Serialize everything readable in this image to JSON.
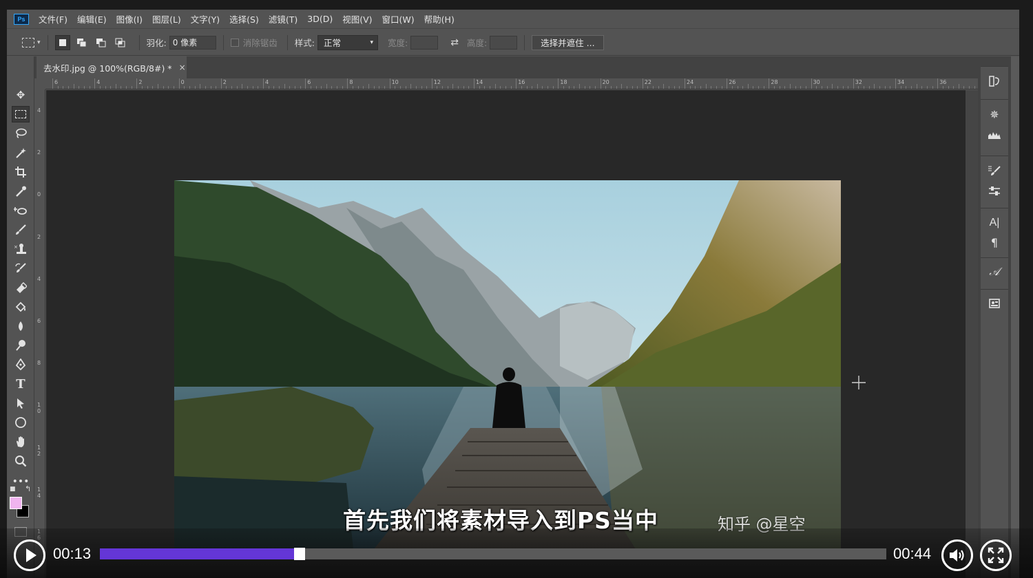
{
  "app": {
    "logo_text": "Ps"
  },
  "menu": [
    "文件(F)",
    "编辑(E)",
    "图像(I)",
    "图层(L)",
    "文字(Y)",
    "选择(S)",
    "滤镜(T)",
    "3D(D)",
    "视图(V)",
    "窗口(W)",
    "帮助(H)"
  ],
  "options_bar": {
    "feather_label": "羽化:",
    "feather_value": "0 像素",
    "antialias_label": "消除锯齿",
    "style_label": "样式:",
    "style_value": "正常",
    "width_label": "宽度:",
    "height_label": "高度:",
    "select_mask_button": "选择并遮住 ..."
  },
  "document": {
    "tab_title": "去水印.jpg @ 100%(RGB/8#) *",
    "close_glyph": "×"
  },
  "ruler": {
    "top_labels": [
      "6",
      "4",
      "2",
      "0",
      "2",
      "4",
      "6",
      "8",
      "10",
      "12",
      "14",
      "16",
      "18",
      "20",
      "22",
      "24",
      "26",
      "28",
      "30",
      "32",
      "34",
      "36"
    ],
    "left_labels": [
      "4",
      "2",
      "0",
      "2",
      "4",
      "6",
      "8",
      "1\n0",
      "1\n2",
      "1\n4",
      "1\n6"
    ]
  },
  "toolbar": {
    "tools": [
      "move-icon",
      "marquee-icon",
      "lasso-icon",
      "magic-wand-icon",
      "crop-icon",
      "eyedropper-icon",
      "healing-brush-icon",
      "brush-icon",
      "clone-stamp-icon",
      "history-brush-icon",
      "eraser-icon",
      "paint-bucket-icon",
      "blur-icon",
      "dodge-icon",
      "pen-icon",
      "type-icon",
      "path-selection-icon",
      "ellipse-icon",
      "hand-icon",
      "zoom-icon",
      "more-tools-icon"
    ],
    "foreground_color": "#f0b4ef",
    "background_color": "#000000"
  },
  "right_panel": {
    "icons": [
      "history-icon",
      "navigator-icon",
      "histogram-icon",
      "brush-settings-icon",
      "adjust-icon",
      "character-icon",
      "paragraph-icon",
      "glyph-icon",
      "library-icon"
    ]
  },
  "video": {
    "subtitle": "首先我们将素材导入到PS当中",
    "watermark": "知乎 @星空",
    "current_time": "00:13",
    "total_time": "00:44",
    "progress": 0.2466,
    "accent_color": "#6436d6"
  }
}
